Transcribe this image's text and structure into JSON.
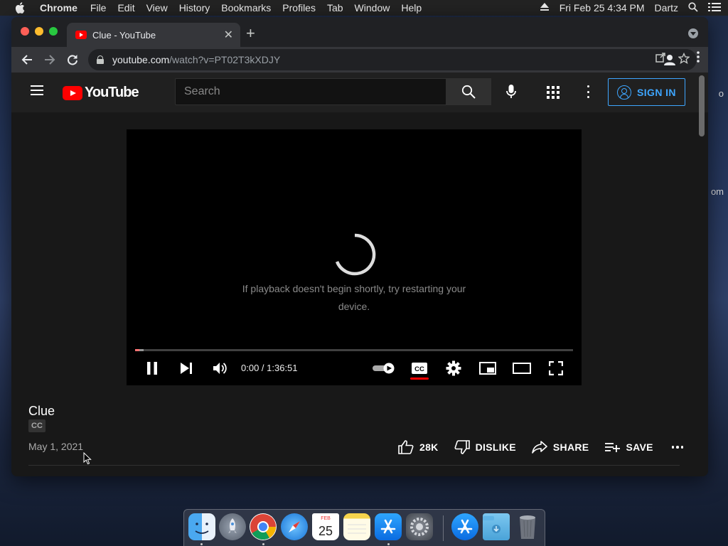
{
  "menubar": {
    "app_name": "Chrome",
    "menus": [
      "File",
      "Edit",
      "View",
      "History",
      "Bookmarks",
      "Profiles",
      "Tab",
      "Window",
      "Help"
    ],
    "datetime": "Fri Feb 25  4:34 PM",
    "user": "Dartz"
  },
  "desktop": {
    "edge_text_1": "o",
    "edge_text_2": "om"
  },
  "browser": {
    "tab_title": "Clue - YouTube",
    "tab_close": "✕",
    "new_tab": "+",
    "url_host": "youtube.com",
    "url_path": "/watch?v=PT02T3kXDJY"
  },
  "youtube": {
    "logo_text": "YouTube",
    "search_placeholder": "Search",
    "sign_in_label": "SIGN IN",
    "player": {
      "message": "If playback doesn't begin shortly, try restarting your device.",
      "time": "0:00 / 1:36:51",
      "progress_fraction": 0.01
    },
    "video": {
      "title": "Clue",
      "badge": "CC",
      "date": "May 1, 2021",
      "likes": "28K",
      "dislike_label": "DISLIKE",
      "share_label": "SHARE",
      "save_label": "SAVE"
    },
    "colors": {
      "brand_red": "#ff0000",
      "link_blue": "#3ea6ff"
    }
  },
  "dock": {
    "apps": [
      "finder-icon",
      "launchpad-icon",
      "chrome-icon",
      "safari-icon",
      "calendar-icon",
      "notes-icon",
      "app-store-icon",
      "system-preferences-icon",
      "app-store-downloads-icon",
      "downloads-folder-icon",
      "trash-icon"
    ],
    "calendar_month": "FEB",
    "calendar_day": "25"
  }
}
